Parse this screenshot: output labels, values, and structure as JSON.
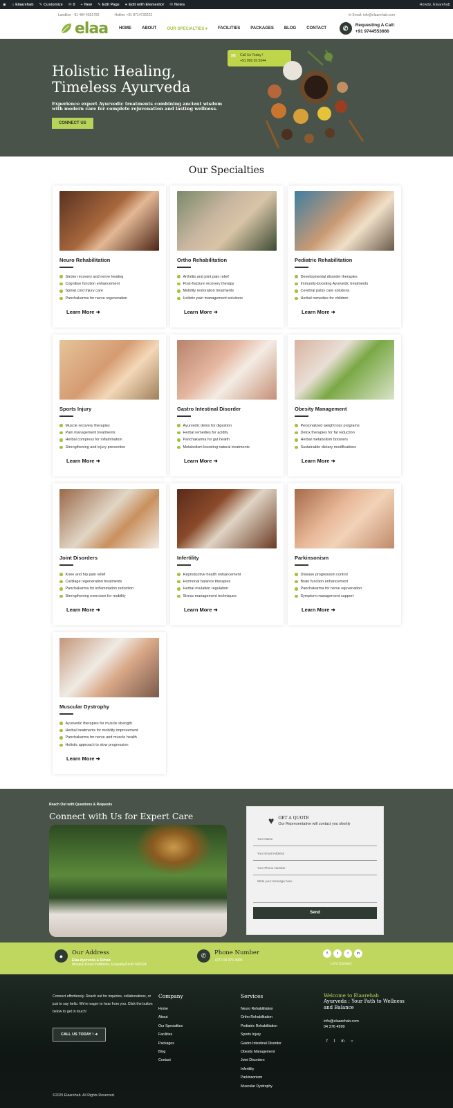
{
  "wpbar": {
    "site": "Elaarehab",
    "customize": "Customize",
    "comments": "0",
    "new": "New",
    "edit_page": "Edit Page",
    "elementor": "Edit with Elementor",
    "notes": "Notes",
    "howdy": "Howdy, Elaarehab"
  },
  "topinfo": {
    "landline": "Landline - 91 484 4551796",
    "hotline": "Hotline +91 8714739222",
    "email": "Email: info@elaarehab.com"
  },
  "logo": "elaa",
  "menu": [
    "HOME",
    "ABOUT",
    "OUR SPECIALTIES",
    "FACILITIES",
    "PACKAGES",
    "BLOG",
    "CONTACT"
  ],
  "menu_active": "OUR SPECIALTIES",
  "call": {
    "label": "Requesting A Call:",
    "number": "+91 9744553666"
  },
  "hero": {
    "title_line1": "Holistic Healing,",
    "title_line2": "Timeless Ayurveda",
    "subtitle": "Experience expert Ayurvedic treatments combining ancient wisdom with modern care for complete rejuvenation and lasting wellness.",
    "button": "CONNECT US",
    "bubble_title": "Call Us Today !",
    "bubble_number": "+91 999 55 5544"
  },
  "specialties": {
    "heading": "Our Specialties",
    "learn_more": "Learn More",
    "cards": [
      {
        "title": "Neuro Rehabilitation",
        "items": [
          "Stroke recovery and nerve healing",
          "Cognitive function enhancement",
          "Spinal cord injury care",
          "Panchakarma for nerve regeneration"
        ]
      },
      {
        "title": "Ortho Rehabilitation",
        "items": [
          "Arthritis and joint pain relief",
          "Post-fracture recovery therapy",
          "Mobility restoration treatments",
          "Holistic pain management solutions"
        ]
      },
      {
        "title": "Pediatric Rehabilitation",
        "items": [
          "Developmental disorder therapies",
          "Immunity-boosting Ayurvedic treatments",
          "Cerebral palsy care solutions",
          "Herbal remedies for children"
        ]
      },
      {
        "title": "Sports Injury",
        "items": [
          "Muscle recovery therapies",
          "Pain management treatments",
          "Herbal compress for inflammation",
          "Strengthening and injury prevention"
        ]
      },
      {
        "title": "Gastro Intestinal Disorder",
        "items": [
          "Ayurvedic detox for digestion",
          "Herbal remedies for acidity",
          "Panchakarma for gut health",
          "Metabolism boosting natural treatments"
        ]
      },
      {
        "title": "Obesity Management",
        "items": [
          "Personalized weight loss programs",
          "Detox therapies for fat reduction",
          "Herbal metabolism boosters",
          "Sustainable dietary modifications"
        ]
      },
      {
        "title": "Joint Disorders",
        "items": [
          "Knee and hip pain relief",
          "Cartilage regeneration treatments",
          "Panchakarma for inflammation reduction",
          "Strengthening exercises for mobility"
        ]
      },
      {
        "title": "Infertility",
        "items": [
          "Reproductive health enhancement",
          "Hormonal balance therapies",
          "Herbal ovulation regulation",
          "Stress management techniques"
        ]
      },
      {
        "title": "Parkinsonism",
        "items": [
          "Disease progression control",
          "Brain function enhancement",
          "Panchakarma for nerve rejuvenation",
          "Symptom management support"
        ]
      },
      {
        "title": "Muscular Dystrophy",
        "items": [
          "Ayurvedic therapies for muscle strength",
          "Herbal treatments for mobility improvement",
          "Panchakarma for nerve and muscle health",
          "Holistic approach to slow progression"
        ]
      }
    ]
  },
  "connect": {
    "small": "Reach Out with Questions & Requests",
    "heading": "Connect with Us for Expert Care",
    "form": {
      "title": "GET A QUOTE",
      "subtitle": "Our Representative will contact you shortly",
      "name": "Your Name",
      "email": "Your Email Address",
      "phone": "Your Phone Number",
      "message": "Write your message here..",
      "send": "Send"
    }
  },
  "band": {
    "address_title": "Our Address",
    "address_name": "Elaa Ayurveda & Rehab",
    "address_line": "Mosque Road,Pallikkara, Edapally,Kochi 682024",
    "phone_title": "Phone Number",
    "phone": "+971 04 376 4999",
    "lets_connect": "Let's Connect"
  },
  "footer": {
    "pitch": "Connect effortlessly. Reach out for inquiries, collaborations, or just to say hello. We're eager to hear from you. Click the button below to get in touch!",
    "button": "CALL US TODAY !",
    "company_title": "Company",
    "company": [
      "Home",
      "About",
      "Our Specialties",
      "Facilities",
      "Packages",
      "Blog",
      "Contact"
    ],
    "services_title": "Services",
    "services": [
      "Neuro Rehabilitation",
      "Ortho Rehabilitation",
      "Pediatric Rehabilitation",
      "Sports Injury",
      "Gastro Intestinal Disorder",
      "Obesity Management",
      "Joint Disorders",
      "Infertility",
      "Parkinsonism",
      "Muscular Dystrophy"
    ],
    "welcome": "Welcome to Elaarehab",
    "tagline": "Ayurveda : Your Path to Wellness and Balance",
    "email": "info@elaarehab.com",
    "phone": "04 376 4999",
    "copyright": "©2025 Elaarehab. All Rights Reserved."
  },
  "colors": {
    "accent": "#b9d35a",
    "dark": "#495349",
    "band": "#bfd75e"
  }
}
